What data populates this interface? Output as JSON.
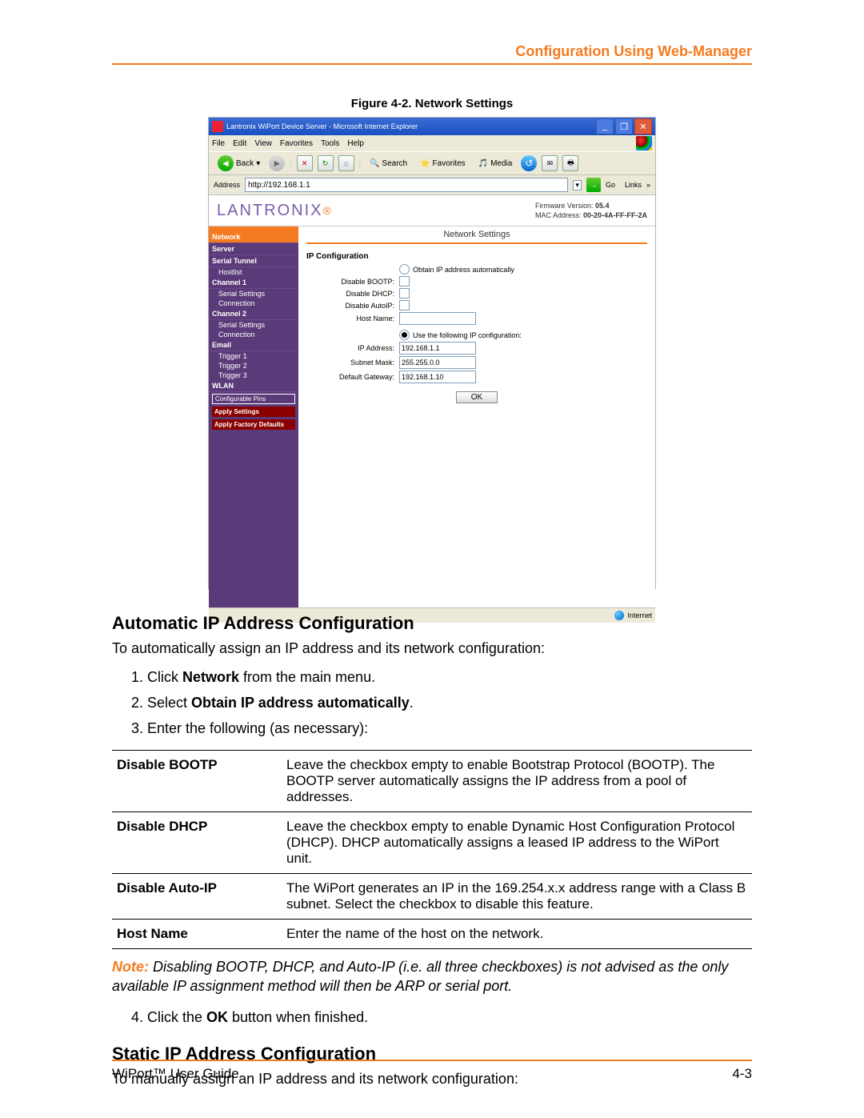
{
  "header": {
    "title": "Configuration Using Web-Manager"
  },
  "figure_caption": "Figure 4-2. Network Settings",
  "screenshot": {
    "window_title": "Lantronix WiPort Device Server - Microsoft Internet Explorer",
    "menus": [
      "File",
      "Edit",
      "View",
      "Favorites",
      "Tools",
      "Help"
    ],
    "back": "Back",
    "search": "Search",
    "favorites": "Favorites",
    "media": "Media",
    "addr_label": "Address",
    "addr_value": "http://192.168.1.1",
    "go": "Go",
    "links": "Links",
    "brand": "LANTRONIX",
    "firmware_label": "Firmware Version:",
    "firmware_value": "05.4",
    "mac_label": "MAC Address:",
    "mac_value": "00-20-4A-FF-FF-2A",
    "main_title": "Network Settings",
    "sidebar": [
      "Network",
      "Server",
      "Serial Tunnel",
      "Hostlist",
      "Channel 1",
      "Serial Settings",
      "Connection",
      "Channel 2",
      "Serial Settings",
      "Connection",
      "Email",
      "Trigger 1",
      "Trigger 2",
      "Trigger 3",
      "WLAN",
      "Configurable Pins",
      "Apply Settings",
      "Apply Factory Defaults"
    ],
    "section": "IP Configuration",
    "opt1": "Obtain IP address automatically",
    "dis_bootp": "Disable BOOTP:",
    "dis_dhcp": "Disable DHCP:",
    "dis_autoip": "Disable AutoIP:",
    "hostname": "Host Name:",
    "opt2": "Use the following IP configuration:",
    "ip_label": "IP Address:",
    "ip_value": "192.168.1.1",
    "subnet_label": "Subnet Mask:",
    "subnet_value": "255.255.0.0",
    "gateway_label": "Default Gateway:",
    "gateway_value": "192.168.1.10",
    "ok": "OK",
    "status": "Internet"
  },
  "h_auto": "Automatic IP Address Configuration",
  "p_auto": "To automatically assign an IP address and its network configuration:",
  "step1_a": "Click ",
  "step1_b": "Network",
  "step1_c": " from the main menu.",
  "step2_a": "Select ",
  "step2_b": "Obtain IP address automatically",
  "step2_c": ".",
  "step3": "Enter the following (as necessary):",
  "table": [
    {
      "k": "Disable BOOTP",
      "v": "Leave the checkbox empty to enable Bootstrap Protocol (BOOTP). The BOOTP server automatically assigns the IP address from a pool of addresses."
    },
    {
      "k": "Disable DHCP",
      "v": "Leave the checkbox empty to enable Dynamic Host Configuration Protocol (DHCP).  DHCP automatically assigns a leased IP address to the WiPort unit."
    },
    {
      "k": "Disable Auto-IP",
      "v": "The WiPort generates an IP in the 169.254.x.x address range with a Class B subnet.  Select the checkbox to disable this feature."
    },
    {
      "k": "Host Name",
      "v": "Enter the name of the host on the network."
    }
  ],
  "note_label": "Note:",
  "note_text": " Disabling BOOTP, DHCP, and Auto-IP (i.e. all three checkboxes) is not advised as the only available IP assignment method will then be ARP or serial port.",
  "step4_a": "Click the ",
  "step4_b": "OK",
  "step4_c": " button when finished.",
  "h_static": "Static IP Address Configuration",
  "p_static": "To manually assign an IP address and its network configuration:",
  "footer": {
    "left": "WiPort™ User Guide",
    "right": "4-3"
  }
}
